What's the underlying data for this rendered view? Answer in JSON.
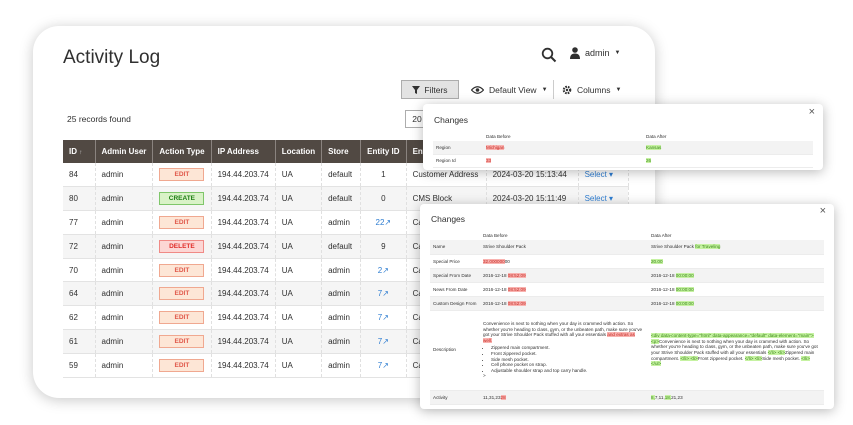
{
  "page": {
    "title": "Activity Log",
    "user": "admin",
    "records_found": "25 records found",
    "per_page": "20",
    "toolbar": {
      "filters": "Filters",
      "view": "Default View",
      "columns": "Columns"
    }
  },
  "grid": {
    "headers": [
      "ID",
      "Admin User",
      "Action Type",
      "IP Address",
      "Location",
      "Store",
      "Entity ID",
      "Entity"
    ],
    "sort_arrow": "↑",
    "rows": [
      {
        "id": "84",
        "user": "admin",
        "action": "EDIT",
        "ip": "194.44.203.74",
        "loc": "UA",
        "store": "default",
        "entity_id": "1",
        "entity": "Customer Address",
        "date": "2024-03-20 15:13:44",
        "select": "Select"
      },
      {
        "id": "80",
        "user": "admin",
        "action": "CREATE",
        "ip": "194.44.203.74",
        "loc": "UA",
        "store": "default",
        "entity_id": "0",
        "entity": "CMS Block",
        "date": "2024-03-20 15:11:49",
        "select": "Select"
      },
      {
        "id": "77",
        "user": "admin",
        "action": "EDIT",
        "ip": "194.44.203.74",
        "loc": "UA",
        "store": "admin",
        "entity_id": "22↗",
        "entity": "Cata",
        "date": "",
        "select": ""
      },
      {
        "id": "72",
        "user": "admin",
        "action": "DELETE",
        "ip": "194.44.203.74",
        "loc": "UA",
        "store": "default",
        "entity_id": "9",
        "entity": "Cata",
        "date": "",
        "select": ""
      },
      {
        "id": "70",
        "user": "admin",
        "action": "EDIT",
        "ip": "194.44.203.74",
        "loc": "UA",
        "store": "admin",
        "entity_id": "2↗",
        "entity": "Cata",
        "date": "",
        "select": ""
      },
      {
        "id": "64",
        "user": "admin",
        "action": "EDIT",
        "ip": "194.44.203.74",
        "loc": "UA",
        "store": "admin",
        "entity_id": "7↗",
        "entity": "Cata",
        "date": "",
        "select": ""
      },
      {
        "id": "62",
        "user": "admin",
        "action": "EDIT",
        "ip": "194.44.203.74",
        "loc": "UA",
        "store": "admin",
        "entity_id": "7↗",
        "entity": "Cata",
        "date": "",
        "select": ""
      },
      {
        "id": "61",
        "user": "admin",
        "action": "EDIT",
        "ip": "194.44.203.74",
        "loc": "UA",
        "store": "admin",
        "entity_id": "7↗",
        "entity": "Cata",
        "date": "",
        "select": ""
      },
      {
        "id": "59",
        "user": "admin",
        "action": "EDIT",
        "ip": "194.44.203.74",
        "loc": "UA",
        "store": "admin",
        "entity_id": "7↗",
        "entity": "Cata",
        "date": "",
        "select": ""
      }
    ]
  },
  "modal1": {
    "title": "Changes",
    "close": "×",
    "col_before": "Data Before",
    "col_after": "Data After",
    "rows": [
      {
        "field": "Region",
        "before": "Michigan",
        "after": "Kansas"
      },
      {
        "field": "Region Id",
        "before": "33",
        "after": "26"
      }
    ]
  },
  "modal2": {
    "title": "Changes",
    "close": "×",
    "col_before": "Data Before",
    "col_after": "Data After",
    "name": {
      "field": "Name",
      "before": "Strive Shoulder Pack",
      "after_plain": "Strive Shoulder Pack",
      "after_add": "for Traveling"
    },
    "special_price": {
      "field": "Special Price",
      "before_del": "32.000000",
      "before_plain": "00",
      "after_add": "20.00"
    },
    "special_from": {
      "field": "Special From Date",
      "before_plain": "2016-12-18",
      "before_del": "08:52:09",
      "after_plain": "2016-12-18",
      "after_add": "00:00:00"
    },
    "news_from": {
      "field": "News From Date",
      "before_plain": "2016-12-18",
      "before_del": "08:52:09",
      "after_plain": "2016-12-18",
      "after_add": "00:00:00"
    },
    "custom_design": {
      "field": "Custom Design From",
      "before_plain": "2016-12-18",
      "before_del": "08:52:09",
      "after_plain": "2016-12-18",
      "after_add": "00:00:00"
    },
    "description": {
      "field": "Description",
      "before_text": "Convenience is next to nothing when your day is crammed with action. So whether you're heading to class, gym, or the unbeaten path, make sure you've got your Strive Shoulder Pack stuffed with all your essentials",
      "before_del": "and extras as well.",
      "bullets": [
        "Zippered main compartment.",
        "Front zippered pocket.",
        "Side mesh pocket.",
        "Cell phone pocket on strap.",
        "Adjustable shoulder strap and top carry handle."
      ],
      "before_end": ">",
      "after_add1": "<div data-content-type=\"html\" data-appearance=\"default\" data-element=\"main\"><p>",
      "after_text1": "Convenience is next to nothing when your day is crammed with action. So whether you're heading to class, gym, or the unbeaten path, make sure you've got your Strive Shoulder Pack stuffed with all your essentials",
      "after_add2": "</li> <li>",
      "after_text2": "Zippered main compartment.",
      "after_add3": "</li> <li>",
      "after_text3": "Front zippered pocket.",
      "after_add4": "</li> <li>",
      "after_text4": "Side mesh pocket.",
      "after_add5": "</li> </ul>"
    },
    "activity": {
      "field": "Activity",
      "before_plain": "11,31,23",
      "before_del": "28",
      "after_add": "8,",
      "after_plain1": "7,11,",
      "after_add2": "18,",
      "after_plain2": "21,23"
    }
  }
}
